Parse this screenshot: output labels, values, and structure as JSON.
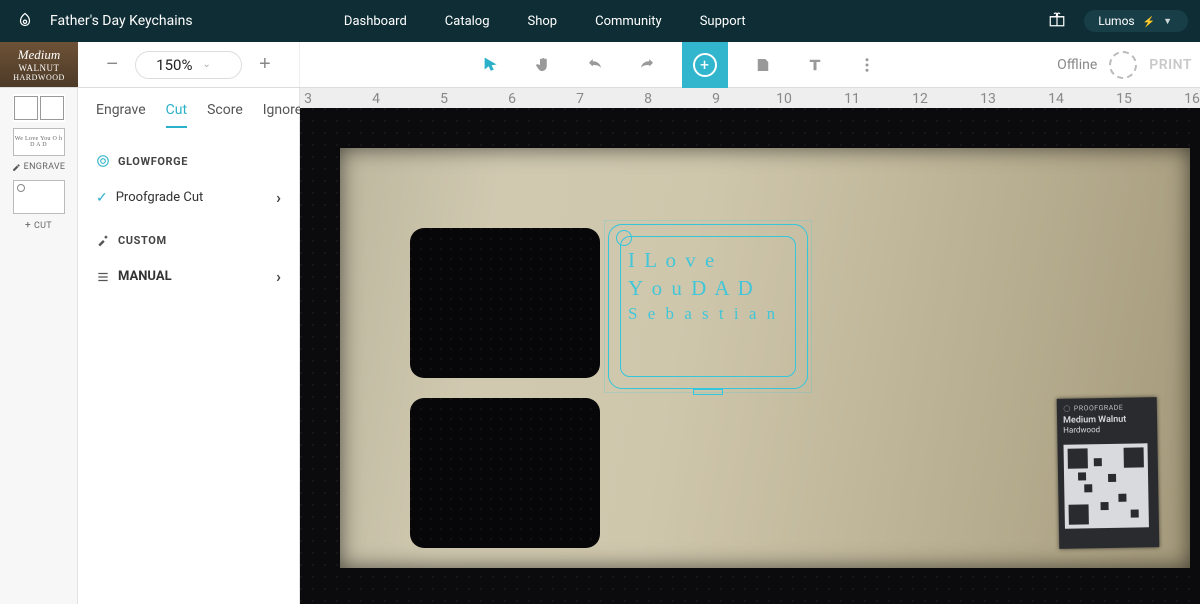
{
  "header": {
    "project_title": "Father's Day Keychains",
    "nav": [
      "Dashboard",
      "Catalog",
      "Shop",
      "Community",
      "Support"
    ],
    "user_name": "Lumos"
  },
  "material": {
    "line1": "Medium",
    "line2": "WALNUT",
    "line3": "HARDWOOD"
  },
  "zoom": {
    "value": "150%"
  },
  "status": {
    "offline": "Offline",
    "print": "PRINT"
  },
  "settings": {
    "tabs": {
      "engrave": "Engrave",
      "cut": "Cut",
      "score": "Score",
      "ignore": "Ignore",
      "active": "cut"
    },
    "section_glowforge": "GLOWFORGE",
    "proofgrade_cut": "Proofgrade Cut",
    "section_custom": "CUSTOM",
    "manual": "MANUAL"
  },
  "layer_strip": {
    "engrave_label": "ENGRAVE",
    "cut_label": "CUT",
    "engrave_thumb_text": "We Love You\nO h D A D"
  },
  "ruler_ticks": [
    3,
    4,
    5,
    6,
    7,
    8,
    9,
    10,
    11,
    12,
    13,
    14,
    15,
    16
  ],
  "design": {
    "engrave_lines": [
      "I L o v e",
      "Y o u  D A D",
      "S e b a s t i a n"
    ]
  },
  "sticker": {
    "brand": "PROOFGRADE",
    "mat1": "Medium Walnut",
    "mat2": "Hardwood"
  }
}
